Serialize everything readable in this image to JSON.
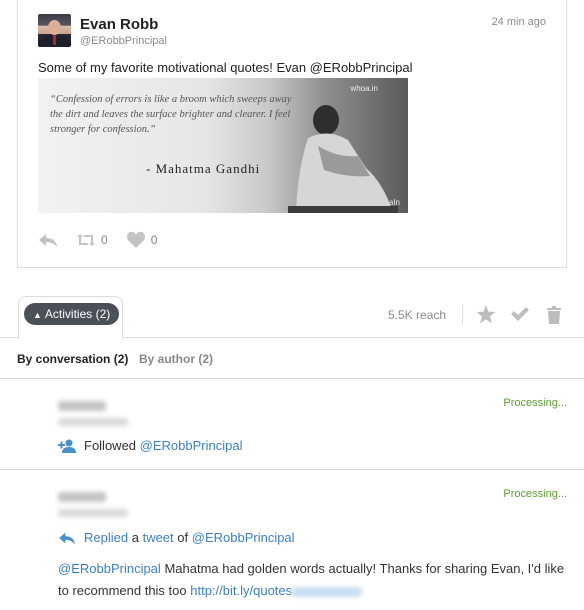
{
  "tweet": {
    "author_name": "Evan Robb",
    "author_handle": "@ERobbPrincipal",
    "time": "24 min ago",
    "text": "Some of my favorite motivational quotes! Evan @ERobbPrincipal",
    "image": {
      "quote": "“Confession of errors is like a broom which sweeps away the dirt and leaves the surface brighter and clearer. I feel stronger for confession.”",
      "signature": "- Mahatma Gandhi",
      "watermark_top": "whoa.in",
      "watermark_bottom": "WhoaIn"
    },
    "retweet_count": "0",
    "like_count": "0"
  },
  "activities_bar": {
    "toggle_label": "Activities (2)",
    "reach": "5.5K reach"
  },
  "subtabs": {
    "by_conversation": "By conversation (2)",
    "by_author": "By author (2)"
  },
  "activities": [
    {
      "status": "Processing...",
      "action_label": "Followed",
      "target": "@ERobbPrincipal"
    },
    {
      "status": "Processing...",
      "action_label": "Replied",
      "connector_a": "a",
      "tweet_link": "tweet",
      "connector_of": "of",
      "target": "@ERobbPrincipal",
      "reply_mention": "@ERobbPrincipal",
      "reply_body": "Mahatma had golden words actually! Thanks for sharing Evan, I'd like to recommend this too",
      "reply_link": "http://bit.ly/quotes"
    }
  ],
  "colors": {
    "link": "#3a7fc4",
    "status": "#5aa030",
    "pill": "#4b5058"
  },
  "icons": [
    "reply-icon",
    "retweet-icon",
    "heart-icon",
    "chevron-up-icon",
    "star-icon",
    "check-icon",
    "trash-icon",
    "add-user-icon"
  ]
}
